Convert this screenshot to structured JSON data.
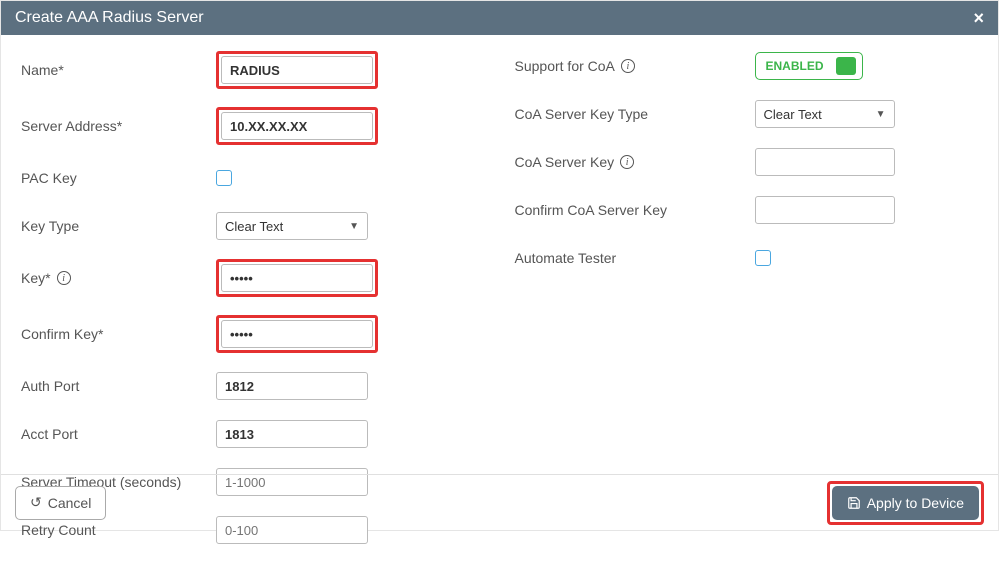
{
  "header": {
    "title": "Create AAA Radius Server",
    "close": "×"
  },
  "left": {
    "name_label": "Name*",
    "name_value": "RADIUS",
    "server_addr_label": "Server Address*",
    "server_addr_value": "10.XX.XX.XX",
    "pac_key_label": "PAC Key",
    "key_type_label": "Key Type",
    "key_type_value": "Clear Text",
    "key_label": "Key*",
    "key_value": "•••••",
    "confirm_key_label": "Confirm Key*",
    "confirm_key_value": "•••••",
    "auth_port_label": "Auth Port",
    "auth_port_value": "1812",
    "acct_port_label": "Acct Port",
    "acct_port_value": "1813",
    "server_timeout_label": "Server Timeout (seconds)",
    "server_timeout_placeholder": "1-1000",
    "retry_count_label": "Retry Count",
    "retry_count_placeholder": "0-100"
  },
  "right": {
    "support_coa_label": "Support for CoA",
    "support_coa_state": "ENABLED",
    "coa_key_type_label": "CoA Server Key Type",
    "coa_key_type_value": "Clear Text",
    "coa_key_label": "CoA Server Key",
    "confirm_coa_key_label": "Confirm CoA Server Key",
    "automate_tester_label": "Automate Tester"
  },
  "footer": {
    "cancel": "Cancel",
    "apply": "Apply to Device"
  }
}
